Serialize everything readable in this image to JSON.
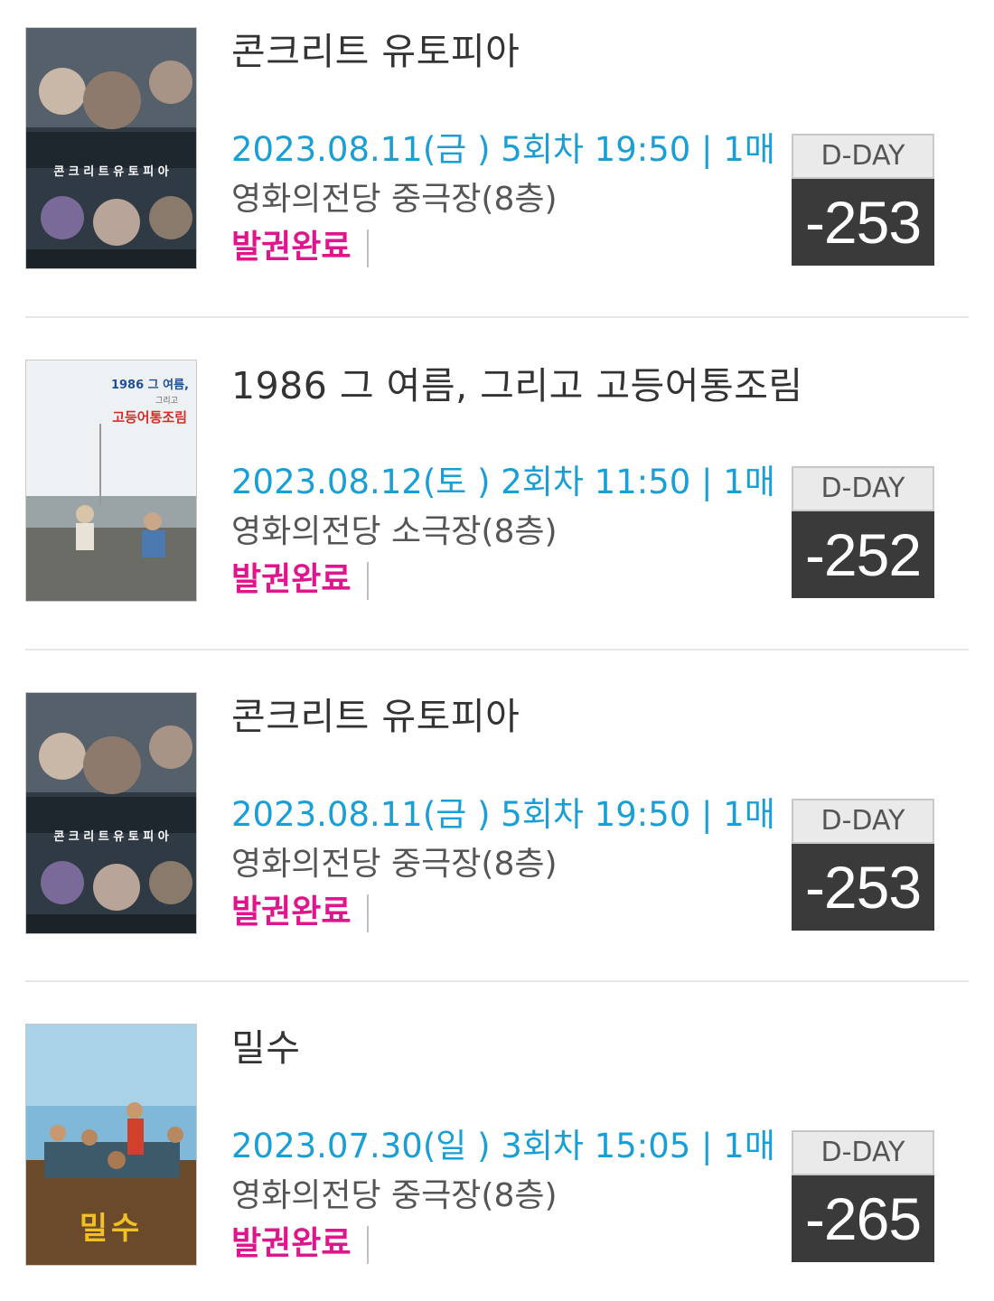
{
  "colors": {
    "showtime": "#1a9ed6",
    "status": "#e0148c",
    "dday_bg": "#3a3a3a",
    "dday_label_bg": "#eaeaea"
  },
  "tickets": [
    {
      "title": "콘크리트 유토피아",
      "showtime": "2023.08.11(금 ) 5회차 19:50 | 1매",
      "venue": "영화의전당 중극장(8층)",
      "status": "발권완료",
      "dday_label": "D-DAY",
      "dday_value": "-253",
      "poster": {
        "icon": "movie-poster-concrete-utopia",
        "text": "콘 크 리 트 유 토 피 아"
      }
    },
    {
      "title": "1986 그 여름, 그리고 고등어통조림",
      "showtime": "2023.08.12(토 ) 2회차 11:50 | 1매",
      "venue": "영화의전당 소극장(8층)",
      "status": "발권완료",
      "dday_label": "D-DAY",
      "dday_value": "-252",
      "poster": {
        "icon": "movie-poster-1986-summer",
        "text_top": "1986 그 여름,",
        "text_mid": "그리고",
        "text_main": "고등어통조림"
      }
    },
    {
      "title": "콘크리트 유토피아",
      "showtime": "2023.08.11(금 ) 5회차 19:50 | 1매",
      "venue": "영화의전당 중극장(8층)",
      "status": "발권완료",
      "dday_label": "D-DAY",
      "dday_value": "-253",
      "poster": {
        "icon": "movie-poster-concrete-utopia",
        "text": "콘 크 리 트 유 토 피 아"
      }
    },
    {
      "title": "밀수",
      "showtime": "2023.07.30(일 ) 3회차 15:05 | 1매",
      "venue": "영화의전당 중극장(8층)",
      "status": "발권완료",
      "dday_label": "D-DAY",
      "dday_value": "-265",
      "poster": {
        "icon": "movie-poster-smugglers",
        "text": "밀수"
      }
    }
  ]
}
